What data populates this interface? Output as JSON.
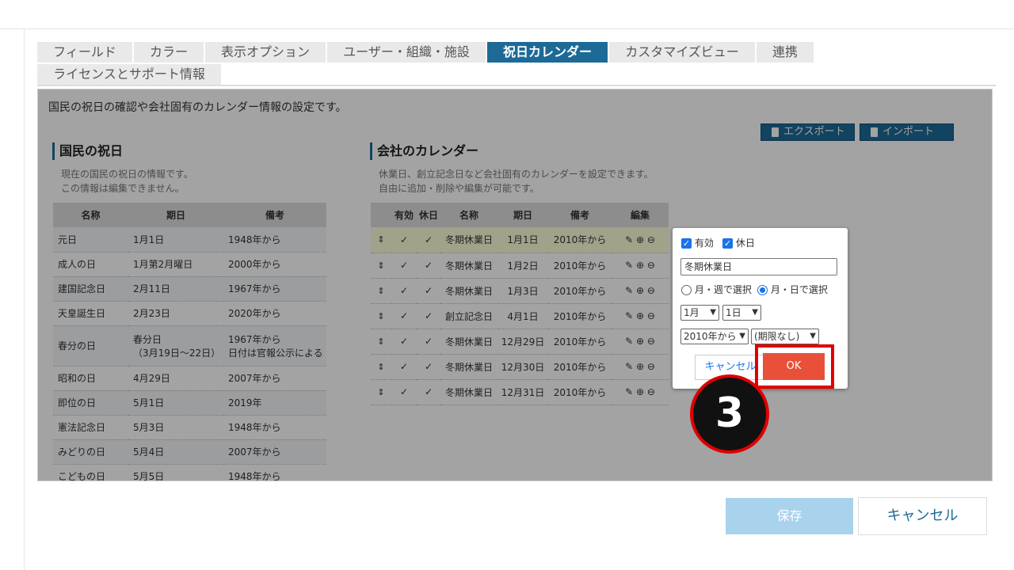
{
  "tabs": [
    "フィールド",
    "カラー",
    "表示オプション",
    "ユーザー・組織・施設",
    "祝日カレンダー",
    "カスタマイズビュー",
    "連携",
    "ライセンスとサポート情報"
  ],
  "active_tab": "祝日カレンダー",
  "intro": "国民の祝日の確認や会社固有のカレンダー情報の設定です。",
  "export_label": "エクスポート",
  "import_label": "インポート",
  "national": {
    "title": "国民の祝日",
    "desc1": "現在の国民の祝日の情報です。",
    "desc2": "この情報は編集できません。",
    "headers": [
      "名称",
      "期日",
      "備考"
    ],
    "rows": [
      {
        "name": "元日",
        "date": "1月1日",
        "date2": "",
        "note": "1948年から",
        "note2": ""
      },
      {
        "name": "成人の日",
        "date": "1月第2月曜日",
        "date2": "",
        "note": "2000年から",
        "note2": ""
      },
      {
        "name": "建国記念日",
        "date": "2月11日",
        "date2": "",
        "note": "1967年から",
        "note2": ""
      },
      {
        "name": "天皇誕生日",
        "date": "2月23日",
        "date2": "",
        "note": "2020年から",
        "note2": ""
      },
      {
        "name": "春分の日",
        "date": "春分日",
        "date2": "（3月19日～22日）",
        "note": "1967年から",
        "note2": "日付は官報公示による"
      },
      {
        "name": "昭和の日",
        "date": "4月29日",
        "date2": "",
        "note": "2007年から",
        "note2": ""
      },
      {
        "name": "即位の日",
        "date": "5月1日",
        "date2": "",
        "note": "2019年",
        "note2": ""
      },
      {
        "name": "憲法記念日",
        "date": "5月3日",
        "date2": "",
        "note": "1948年から",
        "note2": ""
      },
      {
        "name": "みどりの日",
        "date": "5月4日",
        "date2": "",
        "note": "2007年から",
        "note2": ""
      },
      {
        "name": "こどもの日",
        "date": "5月5日",
        "date2": "",
        "note": "1948年から",
        "note2": ""
      }
    ]
  },
  "company": {
    "title": "会社のカレンダー",
    "desc1": "休業日、創立記念日など会社固有のカレンダーを設定できます。",
    "desc2": "自由に追加・削除や編集が可能です。",
    "headers": [
      "",
      "有効",
      "休日",
      "名称",
      "期日",
      "備考",
      "編集"
    ],
    "rows": [
      {
        "name": "冬期休業日",
        "date": "1月1日",
        "note": "2010年から"
      },
      {
        "name": "冬期休業日",
        "date": "1月2日",
        "note": "2010年から"
      },
      {
        "name": "冬期休業日",
        "date": "1月3日",
        "note": "2010年から"
      },
      {
        "name": "創立記念日",
        "date": "4月1日",
        "note": "2010年から"
      },
      {
        "name": "冬期休業日",
        "date": "12月29日",
        "note": "2010年から"
      },
      {
        "name": "冬期休業日",
        "date": "12月30日",
        "note": "2010年から"
      },
      {
        "name": "冬期休業日",
        "date": "12月31日",
        "note": "2010年から"
      }
    ]
  },
  "popup": {
    "valid_label": "有効",
    "holiday_label": "休日",
    "name_value": "冬期休業日",
    "radio_week": "月・週で選択",
    "radio_day": "月・日で選択",
    "month": "1月",
    "day": "1日",
    "from": "2010年から",
    "until": "(期限なし)",
    "cancel": "キャンセル",
    "ok": "OK"
  },
  "step_number": "3",
  "footer": {
    "save": "保存",
    "cancel": "キャンセル"
  }
}
